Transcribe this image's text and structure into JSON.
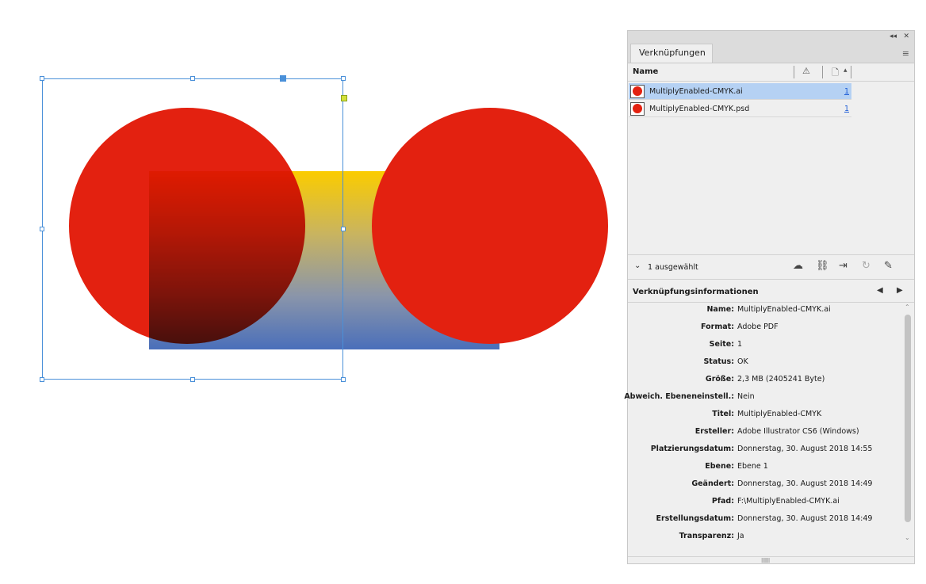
{
  "panel": {
    "titlebar": {
      "collapse_icon": "◂◂",
      "close_icon": "✕"
    },
    "tab_label": "Verknüpfungen",
    "menu_icon": "≡",
    "column_name": "Name",
    "warning_icon": "⚠",
    "page_icon": "🗋",
    "sort_icon": "▴",
    "links": [
      {
        "filename": "MultiplyEnabled-CMYK.ai",
        "page": "1",
        "selected": true
      },
      {
        "filename": "MultiplyEnabled-CMYK.psd",
        "page": "1",
        "selected": false
      }
    ],
    "toolbar": {
      "chevron": "⌄",
      "selection_count": "1 ausgewählt",
      "icons": [
        "cloud-link-icon",
        "relink-icon",
        "go-to-link-icon",
        "update-link-icon",
        "edit-original-icon"
      ],
      "glyphs": [
        "☁",
        "⛓",
        "⇥",
        "↻",
        "✎"
      ]
    },
    "info": {
      "title": "Verknüpfungsinformationen",
      "prev": "◀",
      "next": "▶",
      "rows": [
        {
          "label": "Name:",
          "value": "MultiplyEnabled-CMYK.ai"
        },
        {
          "label": "Format:",
          "value": "Adobe PDF"
        },
        {
          "label": "Seite:",
          "value": "1"
        },
        {
          "label": "Status:",
          "value": "OK"
        },
        {
          "label": "Größe:",
          "value": "2,3 MB (2405241 Byte)"
        },
        {
          "label": "Abweich. Ebeneneinstell.:",
          "value": "Nein"
        },
        {
          "label": "Titel:",
          "value": "MultiplyEnabled-CMYK"
        },
        {
          "label": "Ersteller:",
          "value": "Adobe Illustrator CS6 (Windows)"
        },
        {
          "label": "Platzierungsdatum:",
          "value": "Donnerstag, 30. August 2018 14:55"
        },
        {
          "label": "Ebene:",
          "value": "Ebene 1"
        },
        {
          "label": "Geändert:",
          "value": "Donnerstag, 30. August 2018 14:49"
        },
        {
          "label": "Pfad:",
          "value": "F:\\MultiplyEnabled-CMYK.ai"
        },
        {
          "label": "Erstellungsdatum:",
          "value": "Donnerstag, 30. August 2018 14:49"
        },
        {
          "label": "Transparenz:",
          "value": "Ja"
        }
      ]
    }
  },
  "colors": {
    "circle_red": "#e32110",
    "gradient_top": "#fbcc00",
    "gradient_bottom": "#4a6fba",
    "selection_blue": "#4a90d9",
    "selected_row": "#b5d1f3"
  }
}
